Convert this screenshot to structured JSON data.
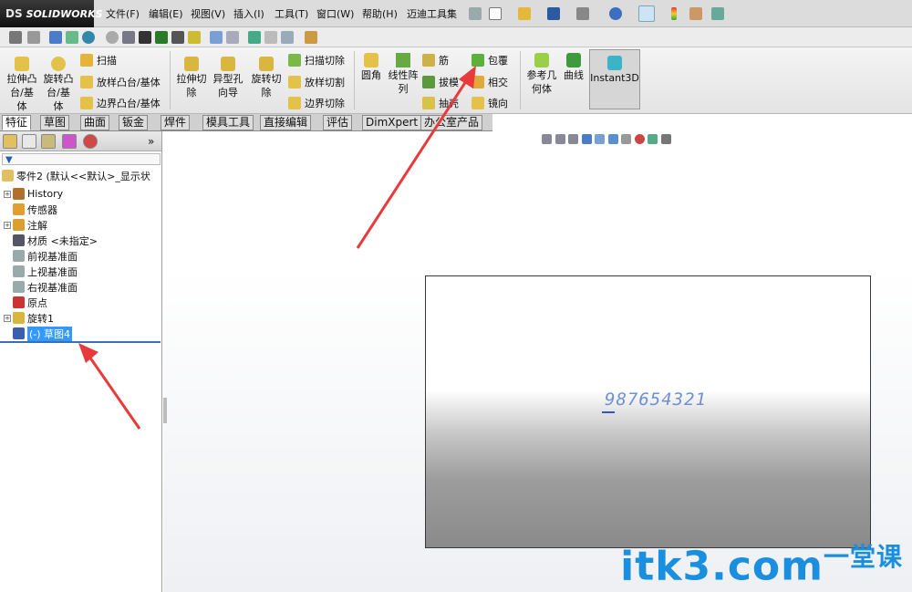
{
  "app": {
    "logo": "SOLIDWORKS",
    "logo_mark": "DS"
  },
  "menu": [
    "文件(F)",
    "编辑(E)",
    "视图(V)",
    "插入(I)",
    "工具(T)",
    "窗口(W)",
    "帮助(H)",
    "迈迪工具集"
  ],
  "command_manager": {
    "extrude_boss": "拉伸凸\n台/基\n体",
    "revolve_boss": "旋转凸\n台/基\n体",
    "sweep": "扫描",
    "loft_boss": "放样凸台/基体",
    "boundary_boss": "边界凸台/基体",
    "extrude_cut": "拉伸切\n除",
    "hole_wizard": "异型孔\n向导",
    "revolve_cut": "旋转切\n除",
    "swept_cut": "扫描切除",
    "lofted_cut": "放样切割",
    "boundary_cut": "边界切除",
    "fillet": "圆角",
    "linear_pattern": "线性阵\n列",
    "rib": "筋",
    "draft": "拔模",
    "shell": "抽壳",
    "wrap": "包覆",
    "intersect": "相交",
    "mirror": "镜向",
    "ref_geometry": "参考几\n何体",
    "curves": "曲线",
    "instant3d": "Instant3D"
  },
  "tabs": [
    "特征",
    "草图",
    "曲面",
    "钣金",
    "焊件",
    "模具工具",
    "直接编辑",
    "评估",
    "DimXpert",
    "办公室产品"
  ],
  "active_tab": "特征",
  "feature_tree": {
    "part": "零件2 (默认<<默认>_显示状",
    "items": [
      {
        "label": "History",
        "expandable": true,
        "icon": "history-icon"
      },
      {
        "label": "传感器",
        "expandable": false,
        "icon": "sensor-icon"
      },
      {
        "label": "注解",
        "expandable": true,
        "icon": "annotation-icon"
      },
      {
        "label": "材质 <未指定>",
        "expandable": false,
        "icon": "material-icon"
      },
      {
        "label": "前视基准面",
        "expandable": false,
        "icon": "plane-icon"
      },
      {
        "label": "上视基准面",
        "expandable": false,
        "icon": "plane-icon"
      },
      {
        "label": "右视基准面",
        "expandable": false,
        "icon": "plane-icon"
      },
      {
        "label": "原点",
        "expandable": false,
        "icon": "origin-icon"
      },
      {
        "label": "旋转1",
        "expandable": true,
        "icon": "revolve-icon"
      },
      {
        "label": "(-) 草图4",
        "expandable": false,
        "icon": "sketch-icon",
        "selected": true
      }
    ]
  },
  "graphics": {
    "sketch_text": "987654321",
    "watermark": "itk3.com",
    "watermark_cn": "一堂课"
  },
  "colors": {
    "accent": "#1a8fe0",
    "selection": "#3399ff",
    "sketch_text": "#6f90d4",
    "arrow": "#e8393b"
  }
}
